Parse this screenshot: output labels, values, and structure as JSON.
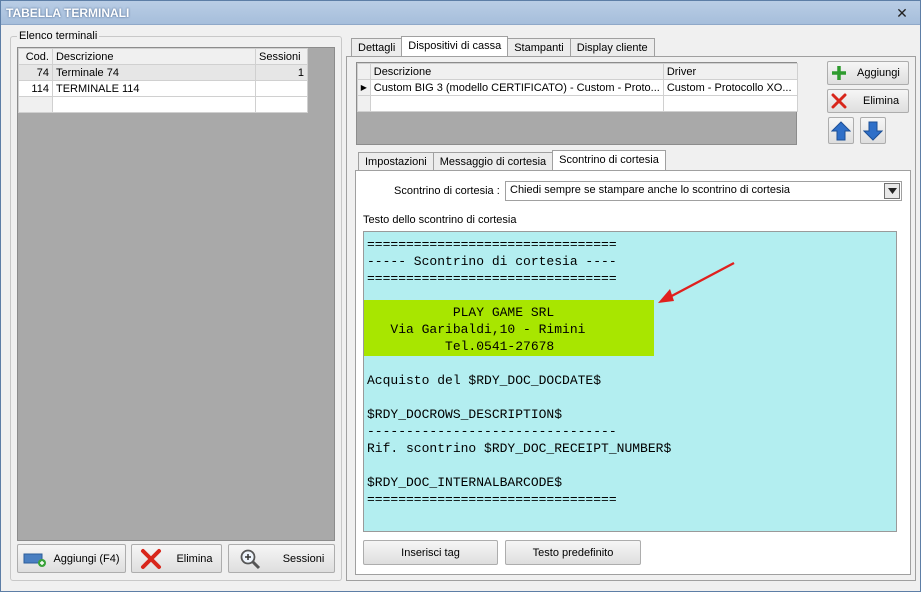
{
  "window": {
    "title": "TABELLA TERMINALI",
    "close_glyph": "✕"
  },
  "terminals": {
    "group_label": "Elenco terminali",
    "columns": [
      "Cod.",
      "Descrizione",
      "Sessioni"
    ],
    "rows": [
      {
        "cod": "74",
        "descrizione": "Terminale 74",
        "sessioni": "1"
      },
      {
        "cod": "114",
        "descrizione": "TERMINALE 114",
        "sessioni": ""
      }
    ],
    "buttons": {
      "add": "Aggiungi (F4)",
      "delete": "Elimina",
      "sessions": "Sessioni"
    }
  },
  "main_tabs": [
    "Dettagli",
    "Dispositivi di cassa",
    "Stampanti",
    "Display cliente"
  ],
  "active_main_tab": "Dispositivi di cassa",
  "devices": {
    "columns": [
      "Descrizione",
      "Driver"
    ],
    "rows": [
      {
        "descrizione": "Custom BIG 3 (modello CERTIFICATO) - Custom - Proto...",
        "driver": "Custom - Protocollo XO..."
      }
    ],
    "buttons": {
      "add": "Aggiungi",
      "delete": "Elimina"
    }
  },
  "sub_tabs": [
    "Impostazioni",
    "Messaggio di cortesia",
    "Scontrino di cortesia"
  ],
  "active_sub_tab": "Scontrino di cortesia",
  "cortesia": {
    "combo_label": "Scontrino di cortesia :",
    "combo_value": "Chiedi sempre se stampare anche lo scontrino di cortesia",
    "text_label": "Testo dello scontrino di cortesia",
    "lines": [
      "================================",
      "----- Scontrino di cortesia ----",
      "================================",
      "",
      "           PLAY GAME SRL",
      "   Via Garibaldi,10 - Rimini",
      "          Tel.0541-27678",
      "",
      "Acquisto del $RDY_DOC_DOCDATE$",
      "",
      "$RDY_DOCROWS_DESCRIPTION$",
      "--------------------------------",
      "Rif. scontrino $RDY_DOC_RECEIPT_NUMBER$",
      "",
      "$RDY_DOC_INTERNALBARCODE$",
      "================================"
    ],
    "highlight_color": "#a8e600",
    "editor_bg": "#b3eef0",
    "buttons": {
      "insert_tag": "Inserisci tag",
      "default_text": "Testo predefinito"
    }
  }
}
